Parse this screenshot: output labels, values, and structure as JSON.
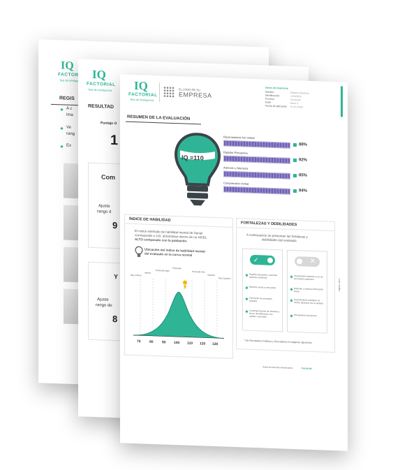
{
  "brand": {
    "iq": "IQ",
    "name": "FACTORIAL",
    "tagline": "Test de Inteligencia",
    "company_logo_line1": "EL LOGO DE SU",
    "company_logo_line2": "EMPRESA"
  },
  "back_sheet": {
    "title": "REGIS",
    "lines": [
      "A c",
      "ima",
      "Ve",
      "rang",
      "Ex"
    ]
  },
  "middle_sheet": {
    "title": "RESULTAD",
    "subtitle": "Puntaje O",
    "big_score": "1",
    "card1_title": "Com",
    "card1_text1": "Ajuste",
    "card1_text2": "rango d",
    "card1_value": "9",
    "card2_title": "Y",
    "card2_text1": "Ajuste",
    "card2_text2": "rango de",
    "card2_value": "8"
  },
  "front_sheet": {
    "header_info": {
      "section": "Datos del Aspirante",
      "fields": [
        {
          "label": "Nombre",
          "value": "Roberto Martínez"
        },
        {
          "label": "Identificación",
          "value": "12345678"
        },
        {
          "label": "Proceso",
          "value": "Consultor"
        },
        {
          "label": "Perfil",
          "value": "Nivel 3"
        },
        {
          "label": "Fecha de aplicación",
          "value": "01-01-2020"
        }
      ]
    },
    "summary_title": "RESUMEN DE LA EVALUACIÓN",
    "iq_label": "IQ =110",
    "bars": [
      {
        "label": "Razonamiento No Verbal",
        "percent": "88%",
        "value": 88
      },
      {
        "label": "Rapidez Perceptiva",
        "percent": "92%",
        "value": 92
      },
      {
        "label": "Atención y Memoria",
        "percent": "85%",
        "value": 85
      },
      {
        "label": "Comprensión Verbal",
        "percent": "94%",
        "value": 94
      }
    ],
    "index_title": "ÍNDICE DE HABILIDAD",
    "index_text1": "El índice estimado de habilidad mental de Daniel",
    "index_text2": "corresponde a 110, ubicándose dentro de un NIVEL",
    "index_text3": "ALTO comparado con la población.",
    "curve_caption1": "Ubicación del índice de habilidad mental",
    "curve_caption2": "del evaluado en la curva normal",
    "curve_categories": [
      "Muy Inferior",
      "Inferior",
      "Promedio Bajo",
      "Promedio",
      "Promedio Alto",
      "Superior",
      "Muy Superior"
    ],
    "curve_ticks": [
      "70",
      "80",
      "90",
      "100",
      "110",
      "120",
      "130"
    ],
    "strengths_title": "FORTALEZAS Y DEBILIDADES",
    "strengths_intro1": "A continuación se presentan las fortalezas y",
    "strengths_intro2": "debilidades del evaluado.",
    "strengths": [
      "Rapidez perceptiva y atención selectiva sostenida",
      "Memoria visual a corto plazo",
      "Formación de conceptos verbales",
      "Contemporización de símbolos y letras; decodificación con rapidez y precisión"
    ],
    "weaknesses": [
      "Visualización espacial y uso de información abstracta",
      "Entender y analizar información visual",
      "Razonamiento analógico no verbal, abstracto con el análisis",
      "Pensamiento secuencial"
    ],
    "footnote": "* Ver Resultados Gráficos y Descriptivos en páginas siguientes.",
    "footer": "Todos los Derechos Reservados",
    "footer_brand": "Factorial",
    "page_num": "Página 1 de 4"
  },
  "colors": {
    "accent": "#2fb596",
    "dark": "#3b4448",
    "bar": "#7468b9"
  }
}
